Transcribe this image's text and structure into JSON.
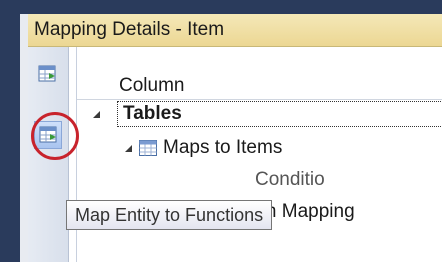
{
  "window": {
    "title": "Mapping Details - Item"
  },
  "toolbar": {
    "buttons": [
      {
        "icon": "map-table-icon"
      },
      {
        "icon": "map-functions-icon"
      }
    ]
  },
  "grid": {
    "column_header": "Column",
    "rows": [
      {
        "label": "Tables"
      },
      {
        "label": "Maps to Items"
      },
      {
        "label": "Conditio"
      },
      {
        "label": "Column Mapping"
      }
    ]
  },
  "tooltip": {
    "text": "Map Entity to Functions"
  },
  "colors": {
    "titlebar": "#ecd793",
    "highlight_circle": "#c8232c",
    "frame": "#2a3b5c"
  }
}
